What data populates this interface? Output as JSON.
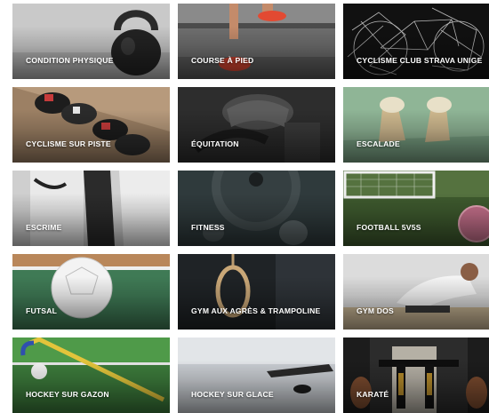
{
  "sports": [
    {
      "id": "condition-physique",
      "label": "CONDITION PHYSIQUE"
    },
    {
      "id": "course-a-pied",
      "label": "COURSE À PIED"
    },
    {
      "id": "cyclisme-club-strava",
      "label": "CYCLISME CLUB STRAVA UNIGE"
    },
    {
      "id": "cyclisme-sur-piste",
      "label": "CYCLISME SUR PISTE"
    },
    {
      "id": "equitation",
      "label": "ÉQUITATION"
    },
    {
      "id": "escalade",
      "label": "ESCALADE"
    },
    {
      "id": "escrime",
      "label": "ESCRIME"
    },
    {
      "id": "fitness",
      "label": "FITNESS"
    },
    {
      "id": "football-5v5",
      "label": "FOOTBALL 5V5S"
    },
    {
      "id": "futsal",
      "label": "FUTSAL"
    },
    {
      "id": "gym-agres-trampoline",
      "label": "GYM AUX AGRÈS & TRAMPOLINE"
    },
    {
      "id": "gym-dos",
      "label": "GYM DOS"
    },
    {
      "id": "hockey-sur-gazon",
      "label": "HOCKEY SUR GAZON"
    },
    {
      "id": "hockey-sur-glace",
      "label": "HOCKEY SUR GLACE"
    },
    {
      "id": "karate",
      "label": "KARATÉ"
    }
  ]
}
